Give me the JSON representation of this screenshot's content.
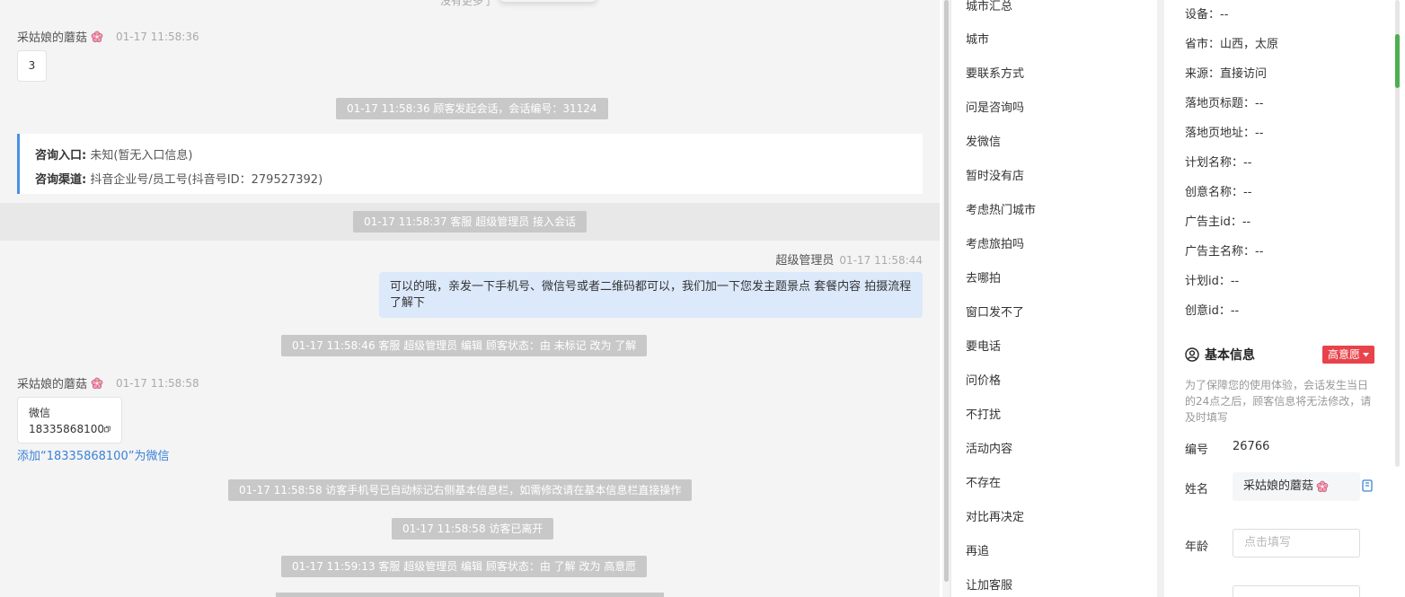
{
  "chat": {
    "top_note": "没有更多了",
    "messages": {
      "visitor_name": "采姑娘的蘑菇",
      "visitor_time_1": "01-17 11:58:36",
      "visitor_text_1": "3",
      "sys_1": "01-17 11:58:36 顾客发起会话，会话编号：31124",
      "info_entry_label": "咨询入口:",
      "info_entry_value": "未知(暂无入口信息)",
      "info_channel_label": "咨询渠道:",
      "info_channel_value": "抖音企业号/员工号(抖音号ID：279527392)",
      "sys_2": "01-17 11:58:37 客服 超级管理员 接入会话",
      "agent_name": "超级管理员",
      "agent_time": "01-17 11:58:44",
      "agent_text": "可以的哦，亲发一下手机号、微信号或者二维码都可以，我们加一下您发主题景点 套餐内容 拍摄流程了解下",
      "sys_3": "01-17 11:58:46 客服 超级管理员 编辑 顾客状态：由 未标记 改为 了解",
      "visitor_time_2": "01-17 11:58:58",
      "wechat_label": "微信",
      "wechat_number": "18335868100",
      "add_wechat_link": "添加“18335868100”为微信",
      "sys_4": "01-17 11:58:58 访客手机号已自动标记右侧基本信息栏，如需修改请在基本信息栏直接操作",
      "sys_5": "01-17 11:58:58 访客已离开",
      "sys_6": "01-17 11:59:13 客服 超级管理员 编辑 顾客状态：由 了解 改为 高意愿"
    }
  },
  "quick_replies": [
    "城市汇总",
    "城市",
    "要联系方式",
    "问是咨询吗",
    "发微信",
    "暂时没有店",
    "考虑热门城市",
    "考虑旅拍吗",
    "去哪拍",
    "窗口发不了",
    "要电话",
    "问价格",
    "不打扰",
    "活动内容",
    "不存在",
    "对比再决定",
    "再追",
    "让加客服"
  ],
  "panel": {
    "device": "设备：--",
    "province": "省市：山西，太原",
    "source": "来源：直接访问",
    "landing_title": "落地页标题：--",
    "landing_url": "落地页地址：--",
    "plan_name": "计划名称：--",
    "creative_name": "创意名称：--",
    "advertiser_id": "广告主id：--",
    "advertiser_name": "广告主名称：--",
    "plan_id": "计划id：--",
    "creative_id": "创意id：--",
    "section_title": "基本信息",
    "intent_badge": "高意愿",
    "hint": "为了保障您的使用体验，会话发生当日的24点之后，顾客信息将无法修改，请及时填写",
    "id_label": "编号",
    "id_value": "26766",
    "name_label": "姓名",
    "name_value": "采姑娘的蘑菇",
    "age_label": "年龄",
    "age_placeholder": "点击填写"
  },
  "colors": {
    "accent": "#4a90e2",
    "badge": "#e8434b",
    "agent_bubble": "#dce9fb",
    "link": "#3b82d9"
  }
}
